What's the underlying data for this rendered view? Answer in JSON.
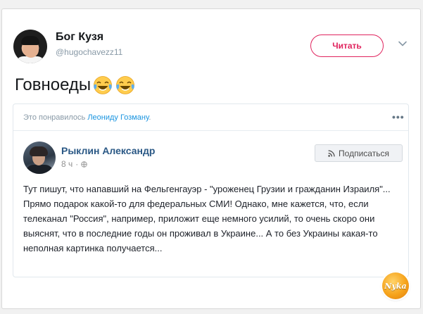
{
  "tweet": {
    "author_name": "Бог Кузя",
    "author_handle": "@hugochavezz11",
    "follow_label": "Читать",
    "text": "Говноеды"
  },
  "quoted_post": {
    "liked_prefix": "Это понравилось",
    "liked_name": "Леониду Гозману",
    "liked_suffix": ".",
    "author_name": "Рыклин Александр",
    "time": "8 ч",
    "separator": "·",
    "subscribe_label": "Подписаться",
    "body": "Тут пишут, что напавший на Фельгенгауэр - \"уроженец Грузии и гражданин Израиля\"... Прямо подарок какой-то для федеральных СМИ! Однако, мне кажется, что, если телеканал \"Россия\", например, приложит еще немного усилий, то очень скоро они выяснят, что в последние годы он проживал в Украине... А то без Украины какая-то неполная картинка получается..."
  },
  "watermark": {
    "text": "Nyka"
  },
  "icons": {
    "emoji": "face-with-tears-of-joy",
    "menu": "chevron-down-icon",
    "more": "more-dots-icon",
    "privacy": "globe-icon",
    "subscribe": "rss-icon"
  },
  "colors": {
    "follow_accent": "#e0245e",
    "link_blue": "#1b95e0",
    "fb_name": "#2a5885"
  }
}
